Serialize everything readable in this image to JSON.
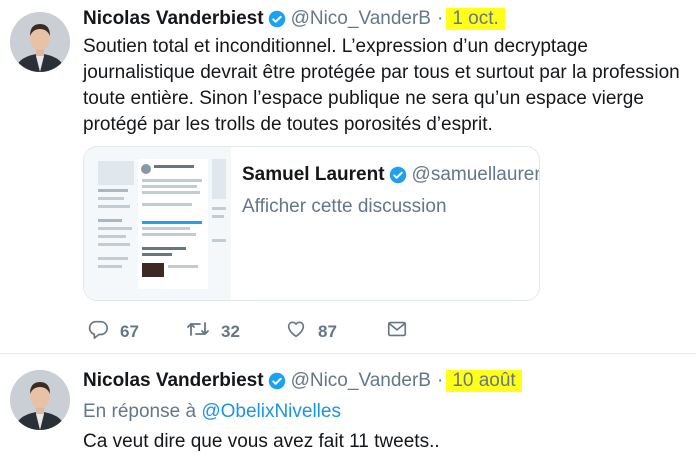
{
  "tweets": [
    {
      "author_name": "Nicolas Vanderbiest",
      "author_handle": "@Nico_VanderB",
      "separator": "·",
      "time": "1 oct.",
      "text": "Soutien total et inconditionnel. L’expression d’un decryptage journalistique devrait être protégée par tous et surtout par la profession toute entière. Sinon l’espace publique ne sera qu’un espace vierge protégé par les trolls de toutes porosités d’esprit.",
      "quote": {
        "author_name": "Samuel Laurent",
        "author_handle": "@samuellaurent",
        "show_thread": "Afficher cette discussion"
      },
      "actions": {
        "replies": "67",
        "retweets": "32",
        "likes": "87"
      }
    },
    {
      "author_name": "Nicolas Vanderbiest",
      "author_handle": "@Nico_VanderB",
      "separator": "·",
      "time": "10 août",
      "reply_prefix": "En réponse à",
      "reply_mention": "@ObelixNivelles",
      "text": "Ca veut dire que vous avez fait 11 tweets.."
    }
  ],
  "colors": {
    "verified": "#1da1f2",
    "highlight": "#ffff1a",
    "link": "#1b95e0",
    "secondary": "#657786"
  }
}
